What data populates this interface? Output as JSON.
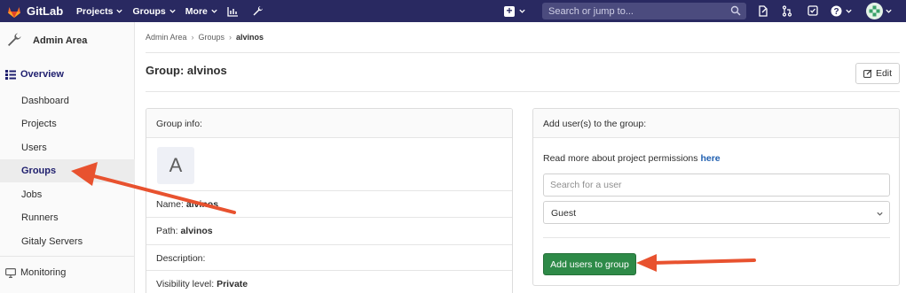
{
  "topbar": {
    "brand": "GitLab",
    "nav": [
      {
        "label": "Projects",
        "name": "nav-projects"
      },
      {
        "label": "Groups",
        "name": "nav-groups"
      },
      {
        "label": "More",
        "name": "nav-more"
      }
    ],
    "search_placeholder": "Search or jump to..."
  },
  "sidebar": {
    "title": "Admin Area",
    "section": "Overview",
    "items": [
      {
        "label": "Dashboard",
        "name": "sidebar-item-dashboard"
      },
      {
        "label": "Projects",
        "name": "sidebar-item-projects"
      },
      {
        "label": "Users",
        "name": "sidebar-item-users"
      },
      {
        "label": "Groups",
        "name": "sidebar-item-groups",
        "active": true
      },
      {
        "label": "Jobs",
        "name": "sidebar-item-jobs"
      },
      {
        "label": "Runners",
        "name": "sidebar-item-runners"
      },
      {
        "label": "Gitaly Servers",
        "name": "sidebar-item-gitaly-servers"
      }
    ],
    "monitoring": "Monitoring"
  },
  "breadcrumb": {
    "items": [
      "Admin Area",
      "Groups"
    ],
    "current": "alvinos"
  },
  "page": {
    "title": "Group: alvinos",
    "edit_label": "Edit"
  },
  "group_info": {
    "header": "Group info:",
    "avatar_letter": "A",
    "name_label": "Name:",
    "name_value": "alvinos",
    "path_label": "Path:",
    "path_value": "alvinos",
    "description_label": "Description:",
    "visibility_label": "Visibility level:",
    "visibility_value": "Private"
  },
  "add_users": {
    "header": "Add user(s) to the group:",
    "permissions_text": "Read more about project permissions",
    "permissions_link": "here",
    "search_placeholder": "Search for a user",
    "role_value": "Guest",
    "submit_label": "Add users to group"
  },
  "colors": {
    "navbar": "#292961",
    "accent": "#1f1f6e",
    "submit": "#2e8a48",
    "annotation_arrow": "#e8522f"
  }
}
